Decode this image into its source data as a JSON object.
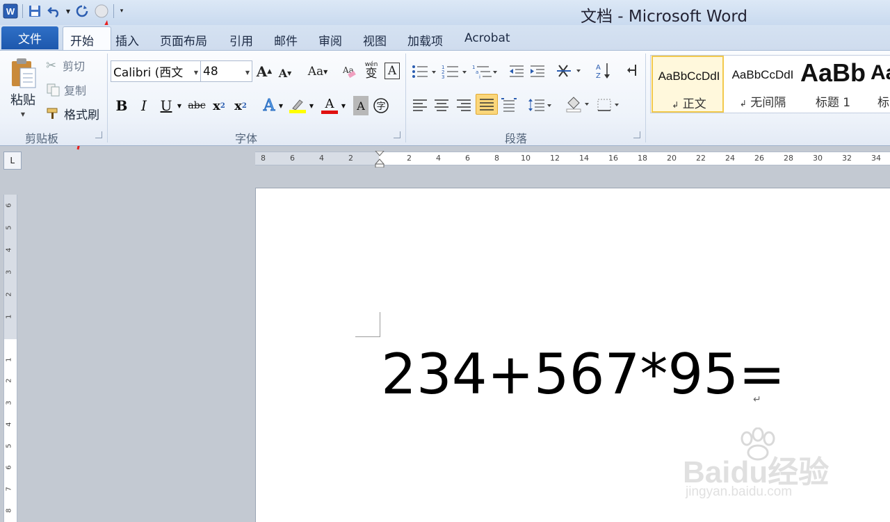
{
  "window": {
    "title": "文档 - Microsoft Word"
  },
  "tabs": {
    "file": "文件",
    "items": [
      "开始",
      "插入",
      "页面布局",
      "引用",
      "邮件",
      "审阅",
      "视图",
      "加载项",
      "Acrobat"
    ]
  },
  "clipboard": {
    "paste": "粘贴",
    "cut": "剪切",
    "copy": "复制",
    "format_painter": "格式刷",
    "group_label": "剪贴板"
  },
  "font": {
    "name": "Calibri (西文",
    "size": "48",
    "group_label": "字体",
    "aa_label": "Aa",
    "wen": "wén",
    "wen_char": "变",
    "strike": "abc"
  },
  "paragraph": {
    "group_label": "段落"
  },
  "styles": [
    {
      "sample": "AaBbCcDdI",
      "name": "正文"
    },
    {
      "sample": "AaBbCcDdI",
      "name": "无间隔"
    },
    {
      "sample": "AaBb",
      "name": "标题 1"
    },
    {
      "sample": "Aa",
      "name": "标"
    }
  ],
  "ruler": {
    "h_left": [
      "8",
      "6",
      "4",
      "2"
    ],
    "h_right": [
      "2",
      "4",
      "6",
      "8",
      "10",
      "12",
      "14",
      "16",
      "18",
      "20",
      "22",
      "24",
      "26",
      "28",
      "30",
      "32",
      "34"
    ],
    "v_top": [
      "6",
      "5",
      "4",
      "3",
      "2",
      "1"
    ],
    "v_bottom": [
      "1",
      "2",
      "3",
      "4",
      "5",
      "6",
      "7",
      "8"
    ]
  },
  "document": {
    "text": "234+567*95="
  },
  "watermark": {
    "text": "Baidu经验",
    "url": "jingyan.baidu.com"
  },
  "colors": {
    "highlight": "#ffff00",
    "font_color": "#e01010",
    "accent": "#1d58ad",
    "annotation_arrow": "#e62020"
  }
}
